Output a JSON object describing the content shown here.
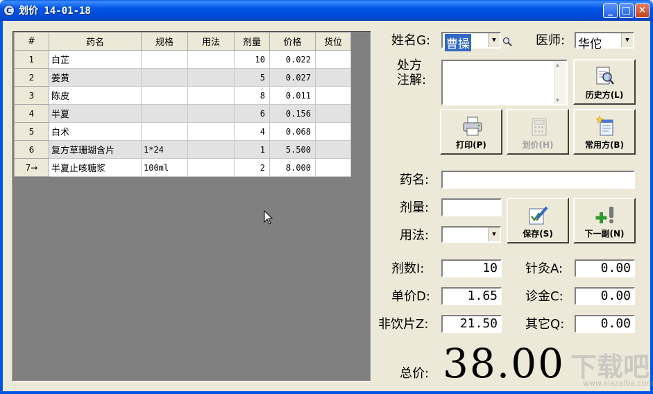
{
  "window": {
    "title": "划价  14-01-18",
    "icon": "app-icon",
    "controls": {
      "minimize": "_",
      "maximize": "□",
      "close": "✕"
    }
  },
  "table": {
    "headers": [
      "#",
      "药名",
      "规格",
      "用法",
      "剂量",
      "价格",
      "货位"
    ],
    "rows": [
      {
        "idx": "1",
        "name": "白芷",
        "spec": "",
        "usage": "",
        "dose": "10",
        "price": "0.022",
        "loc": ""
      },
      {
        "idx": "2",
        "name": "姜黄",
        "spec": "",
        "usage": "",
        "dose": "5",
        "price": "0.027",
        "loc": ""
      },
      {
        "idx": "3",
        "name": "陈皮",
        "spec": "",
        "usage": "",
        "dose": "8",
        "price": "0.011",
        "loc": ""
      },
      {
        "idx": "4",
        "name": "半夏",
        "spec": "",
        "usage": "",
        "dose": "6",
        "price": "0.156",
        "loc": ""
      },
      {
        "idx": "5",
        "name": "白术",
        "spec": "",
        "usage": "",
        "dose": "4",
        "price": "0.068",
        "loc": ""
      },
      {
        "idx": "6",
        "name": "复方草珊瑚含片",
        "spec": "1*24",
        "usage": "",
        "dose": "1",
        "price": "5.500",
        "loc": ""
      },
      {
        "idx": "7→",
        "name": "半夏止咳糖浆",
        "spec": "100ml",
        "usage": "",
        "dose": "2",
        "price": "8.000",
        "loc": ""
      }
    ]
  },
  "patient": {
    "name_label": "姓名G:",
    "name_value": "曹操",
    "doctor_label": "医师:",
    "doctor_value": "华佗"
  },
  "note": {
    "label_line1": "处方",
    "label_line2": "注解:"
  },
  "buttons": {
    "history": "历史方(L)",
    "print": "打印(P)",
    "price": "划价(H)",
    "common": "常用方(B)",
    "save": "保存(S)",
    "next": "下一副(N)"
  },
  "entry": {
    "drug_label": "药名:",
    "dose_label": "剂量:",
    "usage_label": "用法:"
  },
  "fees": {
    "count_label": "剂数I:",
    "count_value": "10",
    "unit_label": "单价D:",
    "unit_value": "1.65",
    "nonpiece_label": "非饮片Z:",
    "nonpiece_value": "21.50",
    "acu_label": "针灸A:",
    "acu_value": "0.00",
    "diag_label": "诊金C:",
    "diag_value": "0.00",
    "other_label": "其它Q:",
    "other_value": "0.00"
  },
  "total": {
    "label": "总价:",
    "value": "38.00"
  },
  "watermark": {
    "text": "下载吧",
    "url": "www.xiazaiba.com"
  }
}
